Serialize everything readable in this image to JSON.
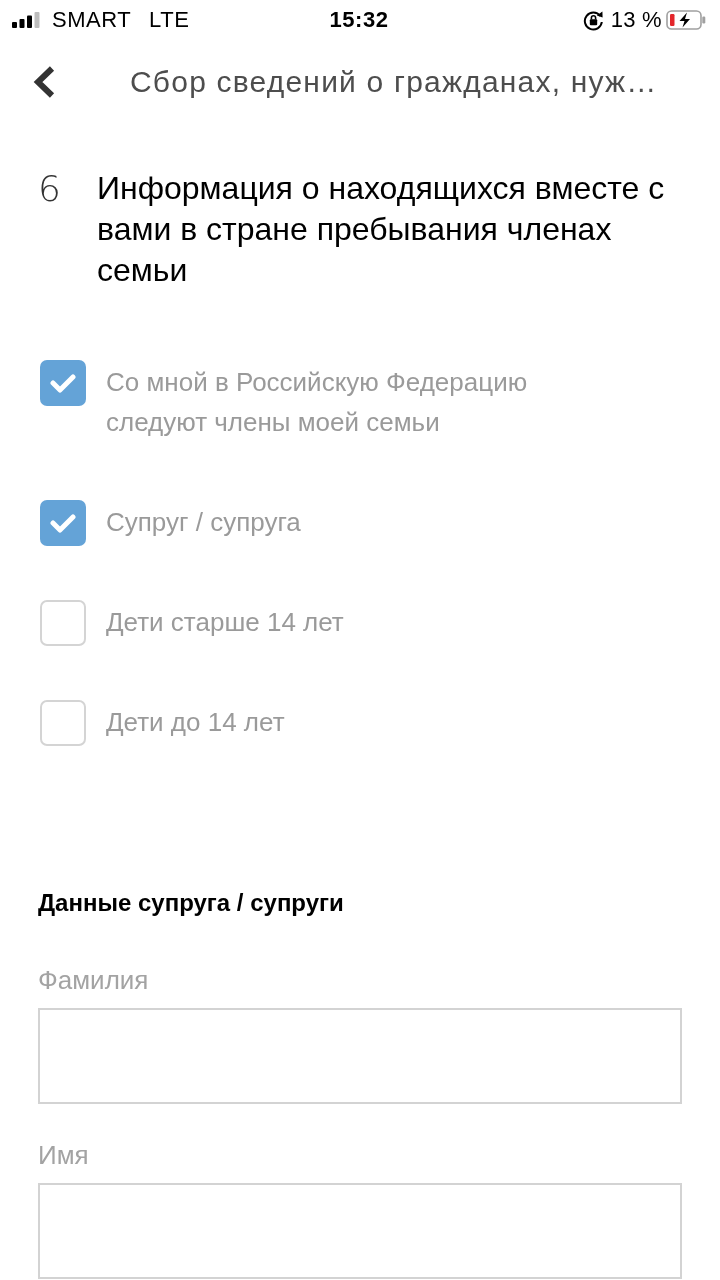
{
  "status_bar": {
    "carrier": "SMART",
    "network": "LTE",
    "time": "15:32",
    "battery": "13 %"
  },
  "nav": {
    "title": "Сбор сведений о гражданах, нуж…"
  },
  "question": {
    "number": "6",
    "title": "Информация о находящихся вместе с вами в стране пребывания членах семьи"
  },
  "options": [
    {
      "label": "Со мной в Российскую Федерацию следуют члены моей семьи",
      "checked": true
    },
    {
      "label": "Супруг / супруга",
      "checked": true
    },
    {
      "label": "Дети старше 14 лет",
      "checked": false
    },
    {
      "label": "Дети до 14 лет",
      "checked": false
    }
  ],
  "spouse_section": {
    "heading": "Данные супруга / супруги",
    "fields": [
      {
        "label": "Фамилия"
      },
      {
        "label": "Имя"
      }
    ]
  }
}
